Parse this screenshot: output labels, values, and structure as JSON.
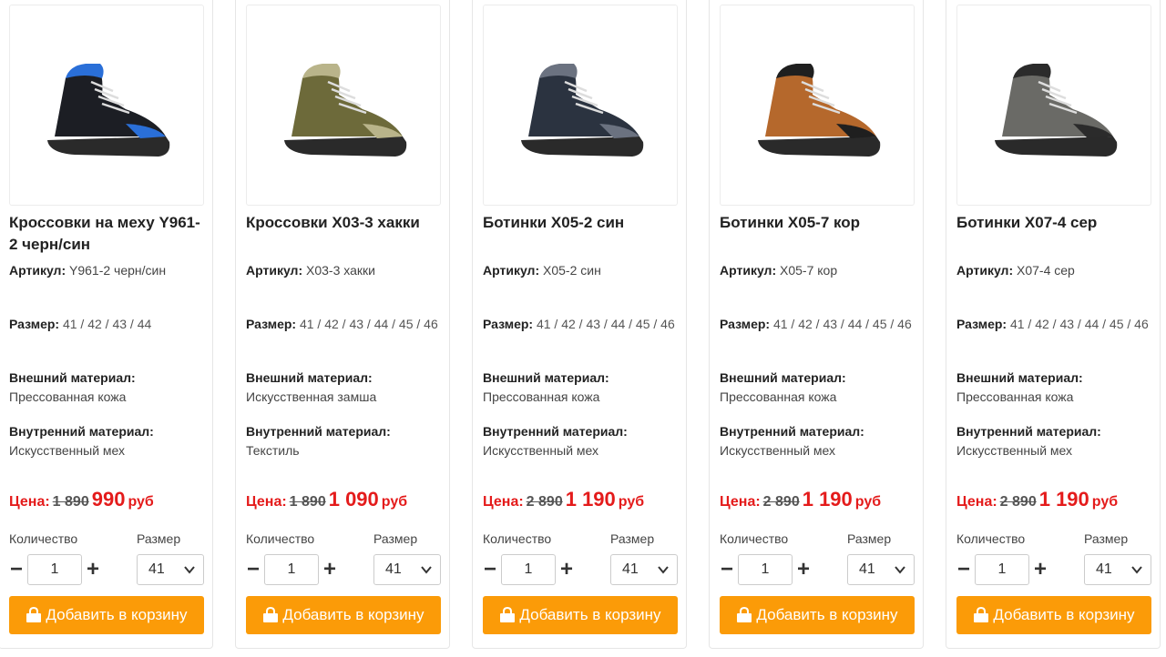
{
  "labels": {
    "article": "Артикул:",
    "size": "Размер:",
    "outer": "Внешний материал:",
    "inner": "Внутренний материал:",
    "price": "Цена:",
    "currency": "руб",
    "qty_label": "Количество",
    "size_label": "Размер",
    "add_to_cart": "Добавить в корзину"
  },
  "products": [
    {
      "title": "Кроссовки на меху Y961-2 черн/син",
      "article": "Y961-2 черн/син",
      "sizes": "41 / 42 / 43 / 44",
      "outer_material": "Прессованная кожа",
      "inner_material": "Искусственный мех",
      "old_price": "1 890",
      "new_price": "990",
      "quantity": "1",
      "selected_size": "41",
      "color": "#1c1e24",
      "accent": "#2a6fd8"
    },
    {
      "title": "Кроссовки Х03-3 хакки",
      "article": "Х03-3 хакки",
      "sizes": "41 / 42 / 43 / 44 / 45 / 46",
      "outer_material": "Искусственная замша",
      "inner_material": "Текстиль",
      "old_price": "1 890",
      "new_price": "1 090",
      "quantity": "1",
      "selected_size": "41",
      "color": "#6d6a3a",
      "accent": "#b9b48a"
    },
    {
      "title": "Ботинки Х05-2 син",
      "article": "Х05-2 син",
      "sizes": "41 / 42 / 43 / 44 / 45 / 46",
      "outer_material": "Прессованная кожа",
      "inner_material": "Искусственный мех",
      "old_price": "2 890",
      "new_price": "1 190",
      "quantity": "1",
      "selected_size": "41",
      "color": "#2b3340",
      "accent": "#6b7280"
    },
    {
      "title": "Ботинки Х05-7 кор",
      "article": "Х05-7 кор",
      "sizes": "41 / 42 / 43 / 44 / 45 / 46",
      "outer_material": "Прессованная кожа",
      "inner_material": "Искусственный мех",
      "old_price": "2 890",
      "new_price": "1 190",
      "quantity": "1",
      "selected_size": "41",
      "color": "#b5682c",
      "accent": "#1f1f1f"
    },
    {
      "title": "Ботинки Х07-4 сер",
      "article": "Х07-4 сер",
      "sizes": "41 / 42 / 43 / 44 / 45 / 46",
      "outer_material": "Прессованная кожа",
      "inner_material": "Искусственный мех",
      "old_price": "2 890",
      "new_price": "1 190",
      "quantity": "1",
      "selected_size": "41",
      "color": "#6a6a66",
      "accent": "#2b2b2b"
    }
  ]
}
